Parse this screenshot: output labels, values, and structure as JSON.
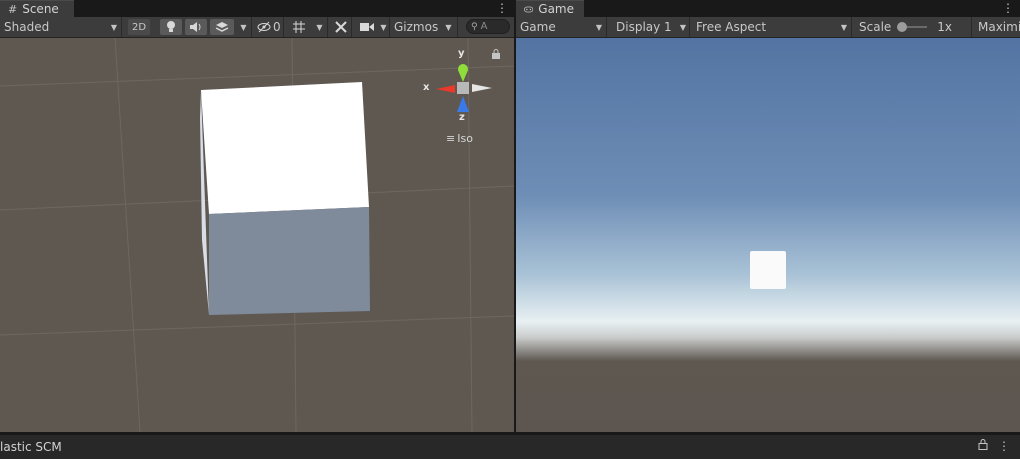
{
  "scene": {
    "tab_label": "Scene",
    "toolbar": {
      "shading_mode": "Shaded",
      "mode_2d": "2D",
      "hidden_count": "0",
      "gizmos_label": "Gizmos",
      "search_placeholder": "A"
    },
    "gizmo": {
      "y_label": "y",
      "x_label": "x",
      "z_label": "z",
      "view_label": "Iso"
    }
  },
  "game": {
    "tab_label": "Game",
    "toolbar": {
      "view_mode": "Game",
      "display": "Display 1",
      "aspect": "Free Aspect",
      "scale_label": "Scale",
      "scale_value": "1x",
      "maximize_label": "Maximi"
    }
  },
  "bottom": {
    "tab_label": "lastic SCM"
  },
  "colors": {
    "scene_background": "#5f5851",
    "x_axis": "#e8392a",
    "y_axis": "#8fdc3a",
    "z_axis": "#3a7ae8"
  }
}
